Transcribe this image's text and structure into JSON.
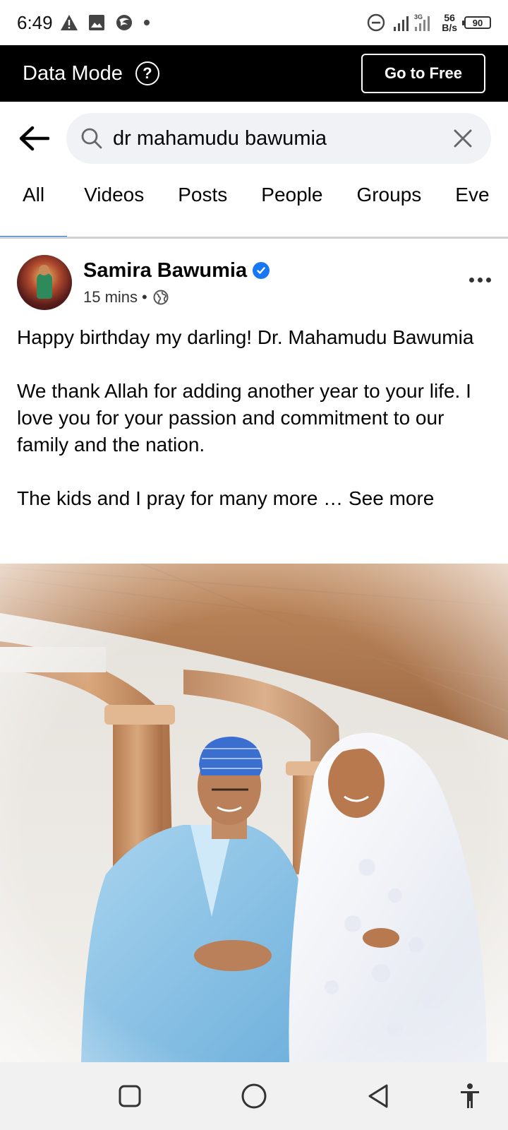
{
  "status_bar": {
    "time": "6:49",
    "net_speed_value": "56",
    "net_speed_unit": "B/s",
    "network_type": "3G",
    "battery": "90",
    "icons": [
      "warning-icon",
      "image-icon",
      "app-icon",
      "dot-icon",
      "dnd-icon",
      "signal-icon"
    ]
  },
  "data_mode": {
    "title": "Data Mode",
    "help_symbol": "?",
    "go_free_label": "Go to Free"
  },
  "search": {
    "query": "dr mahamudu bawumia"
  },
  "tabs": [
    {
      "label": "All",
      "active": true
    },
    {
      "label": "Videos",
      "active": false
    },
    {
      "label": "Posts",
      "active": false
    },
    {
      "label": "People",
      "active": false
    },
    {
      "label": "Groups",
      "active": false
    },
    {
      "label": "Eve",
      "active": false
    }
  ],
  "post": {
    "author": "Samira Bawumia",
    "verified": true,
    "time": "15 mins",
    "separator": "•",
    "privacy": "public-globe-icon",
    "paragraphs": [
      "Happy birthday my darling! Dr. Mahamudu Bawumia",
      "We thank Allah for adding another year to your life. I love you for your passion and commitment to our family and the nation."
    ],
    "truncated_line": "The kids and I pray for many more …",
    "see_more_label": "See more"
  },
  "colors": {
    "accent_blue": "#1877f2",
    "data_mode_bg": "#000000",
    "search_bg": "#f0f2f5"
  }
}
